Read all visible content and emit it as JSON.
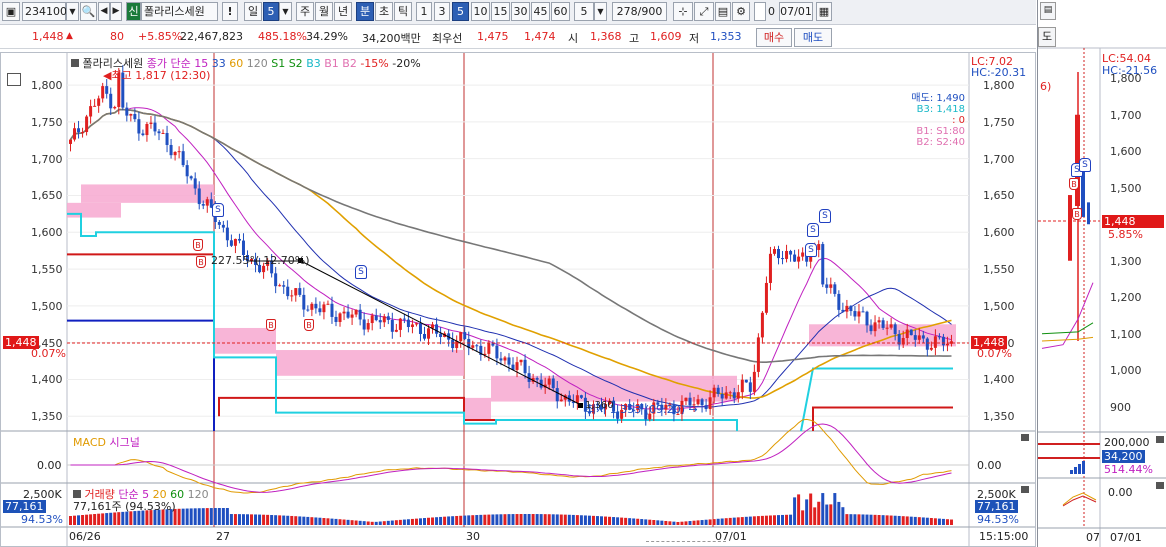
{
  "toolbar": {
    "code": "234100",
    "new_badge": "신",
    "stock_name": "폴라리스세원",
    "alert": "!",
    "period_day": "일",
    "period_day_count": "5",
    "btn_week": "주",
    "btn_month": "월",
    "btn_year": "년",
    "btn_minute": "분",
    "btn_second": "초",
    "btn_tick": "틱",
    "intervals": [
      "1",
      "3",
      "5",
      "10",
      "15",
      "30",
      "45",
      "60"
    ],
    "selected_interval": "5",
    "count_value": "5",
    "range_value": "278/900",
    "zero_check": "0",
    "date_value": "07/01"
  },
  "quote": {
    "price": "1,448",
    "change": "80",
    "change_pct": "+5.85%",
    "volume": "22,467,823",
    "vol_ratio": "485.18%",
    "turnover": "34.29%",
    "amount": "34,200백만",
    "best_bid_label": "최우선",
    "best_ask": "1,475",
    "best_bid": "1,474",
    "open_label": "시",
    "open": "1,368",
    "high_label": "고",
    "high": "1,609",
    "low_label": "저",
    "low": "1,353",
    "buy_button": "매수",
    "sell_button": "매도"
  },
  "price_panel": {
    "legend_name": "폴라리스세원",
    "legend_ma": "종가 단순",
    "ma_periods": [
      "15",
      "33",
      "60",
      "120"
    ],
    "legend_s": [
      "S1",
      "S2"
    ],
    "legend_b": [
      "B3",
      "B1",
      "B2"
    ],
    "legend_pct": [
      "-15%",
      "-20%"
    ],
    "lc": "LC:7.02",
    "hc": "HC:-20.31",
    "high_marker": "최고 1,817 (12:30)",
    "low_marker": "최저 1,353 (09:20)",
    "trend_label": "227.55°(-12.70%)",
    "trend_end": "1,360",
    "price_tag": "1,448",
    "pct_tag": "0.07%",
    "right_price_tag": "1,448",
    "right_pct_tag": "0.07%",
    "signal_sell": "매도: 1,490",
    "signal_b3": "B3: 1,418",
    "signal_zero": ": 0",
    "signal_b1": "B1: S1:80",
    "signal_b2": "B2: S2:40",
    "y_ticks": [
      "1,800",
      "1,750",
      "1,700",
      "1,650",
      "1,600",
      "1,550",
      "1,500",
      "1,450",
      "1,400",
      "1,350"
    ]
  },
  "macd_panel": {
    "label_macd": "MACD",
    "label_signal": "시그널",
    "zero_label": "0.00",
    "zero_label_right": "0.00"
  },
  "volume_panel": {
    "label": "거래량",
    "ma_label": "단순",
    "periods": [
      "5",
      "20",
      "60",
      "120"
    ],
    "current": "77,161주 (94.53%)",
    "top_tick": "2,500K",
    "top_tick_right": "2,500K",
    "vol_tag": "77,161",
    "vol_pct": "94.53%",
    "vol_tag_right": "77,161",
    "vol_pct_right": "94.53%"
  },
  "x_axis": {
    "labels": [
      "06/26",
      "27",
      "30",
      "07/01"
    ],
    "time_end": "15:15:00"
  },
  "right_mini": {
    "tab_label": "도",
    "lc": "LC:54.04",
    "hc": "HC:-21.56",
    "partial_label": "6)",
    "y_ticks": [
      "1,800",
      "1,700",
      "1,600",
      "1,500",
      "1,400",
      "1,300",
      "1,200",
      "1,100",
      "1,000",
      "900"
    ],
    "price_tag": "1,448",
    "pct_tag": "5.85%",
    "vol_top": "200,000",
    "vol_tag": "34,200",
    "vol_pct": "514.44%",
    "zero": "0.00",
    "x_labels": [
      "07",
      "07/01"
    ]
  },
  "colors": {
    "up": "#e02020",
    "down": "#1f4fc0",
    "ma15": "#c020c0",
    "ma33": "#2030b0",
    "ma60": "#e0a000",
    "ma120": "#777777",
    "cloud": "#f7a8d0",
    "b3": "#20d0e0",
    "selected": "#2d5fb4"
  },
  "chart_data": {
    "type": "candlestick",
    "x_sessions": [
      "06/26",
      "27",
      "30",
      "07/01"
    ],
    "ylim": [
      1330,
      1830
    ],
    "high": 1817,
    "low": 1353,
    "last": 1448,
    "close_path": [
      1720,
      1760,
      1790,
      1770,
      1745,
      1740,
      1720,
      1680,
      1640,
      1610,
      1580,
      1560,
      1545,
      1520,
      1505,
      1495,
      1490,
      1485,
      1480,
      1478,
      1475,
      1470,
      1462,
      1455,
      1448,
      1440,
      1430,
      1415,
      1400,
      1385,
      1372,
      1365,
      1362,
      1360,
      1358,
      1360,
      1362,
      1365,
      1370,
      1378,
      1385,
      1390,
      1560,
      1575,
      1560,
      1540,
      1510,
      1490,
      1480,
      1470,
      1460,
      1455,
      1450,
      1448
    ]
  }
}
